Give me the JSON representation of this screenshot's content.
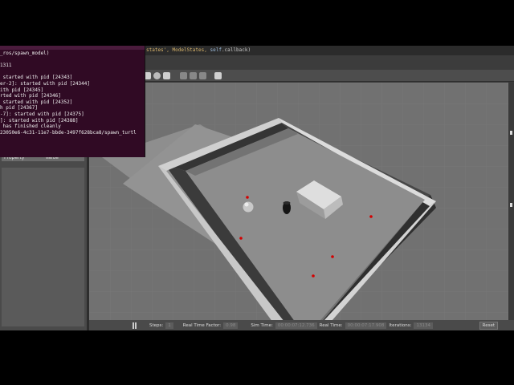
{
  "code_strip": {
    "pre": "states', ModelStates, ",
    "keyword": "self",
    "post": ".callback)"
  },
  "terminal": {
    "lines": [
      "_ros/spawn_model)",
      "",
      "1311",
      "",
      " started with pid [24343]",
      "er-2]: started with pid [24344]",
      "ith pid [24345]",
      "rted with pid [24346]",
      " started with pid [24352]",
      "h pid [24367]",
      "-7]: started with pid [24375]",
      "]: started with pid [24388]",
      " has finished cleanly",
      "23050e6-4c31-11e7-bbde-3497f628bca8/spawn_turtl"
    ]
  },
  "left_panel": {
    "property_header": "Property",
    "value_header": "Value"
  },
  "statusbar": {
    "steps_label": "Steps:",
    "steps_value": "1",
    "rtf_label": "Real Time Factor:",
    "rtf_value": "0.98",
    "sim_label": "Sim Time:",
    "sim_value": "00:00:07:12.736",
    "real_label": "Real Time:",
    "real_value": "00:00:07:17.908",
    "iter_label": "Iterations:",
    "iter_value": "13134",
    "reset_label": "Reset"
  },
  "colors": {
    "terminal_bg": "#300a24",
    "ground": "#8c8c8c",
    "wall_top": "#d8d8d8",
    "wall_side": "#3a3a3a",
    "marker": "#d40000"
  }
}
